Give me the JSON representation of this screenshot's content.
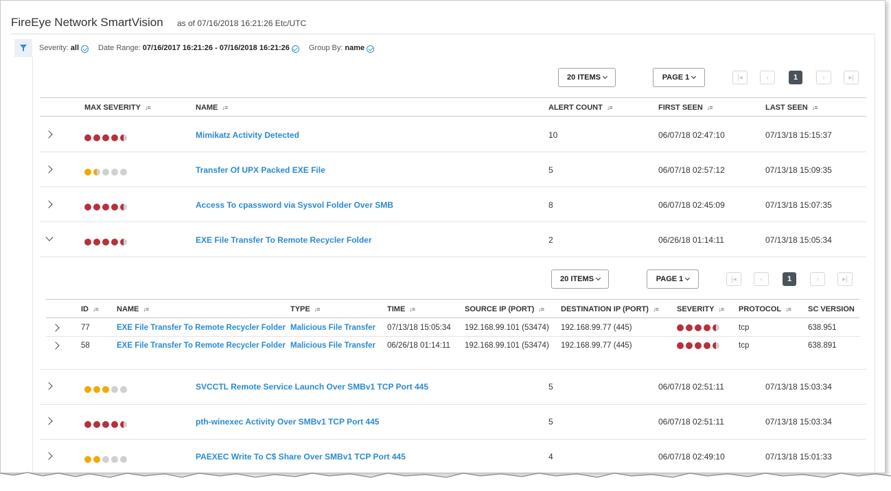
{
  "app": {
    "title": "FireEye Network SmartVision",
    "as_of": "as of 07/16/2018 16:21:26 Etc/UTC"
  },
  "filters": {
    "severity_label": "Severity:",
    "severity_value": "all",
    "date_label": "Date Range:",
    "date_value": "07/16/2017 16:21:26 - 07/16/2018 16:21:26",
    "group_label": "Group By:",
    "group_value": "name"
  },
  "pager": {
    "items_label": "20 ITEMS",
    "page_label": "PAGE 1",
    "current_page": "1"
  },
  "table": {
    "headers": {
      "max_severity": "MAX SEVERITY",
      "name": "NAME",
      "alert_count": "ALERT COUNT",
      "first_seen": "FIRST SEEN",
      "last_seen": "LAST SEEN"
    },
    "rows": [
      {
        "name": "Mimikatz Activity Detected",
        "alert_count": "10",
        "first_seen": "06/07/18 02:47:10",
        "last_seen": "07/13/18 15:15:37",
        "severity": 4.5,
        "color": "red",
        "expanded": false
      },
      {
        "name": "Transfer Of UPX Packed EXE File",
        "alert_count": "5",
        "first_seen": "06/07/18 02:57:12",
        "last_seen": "07/13/18 15:09:35",
        "severity": 1.5,
        "color": "orange",
        "expanded": false
      },
      {
        "name": "Access To cpassword via Sysvol Folder Over SMB",
        "alert_count": "8",
        "first_seen": "06/07/18 02:45:09",
        "last_seen": "07/13/18 15:07:35",
        "severity": 4.5,
        "color": "red",
        "expanded": false
      },
      {
        "name": "EXE File Transfer To Remote Recycler Folder",
        "alert_count": "2",
        "first_seen": "06/26/18 01:14:11",
        "last_seen": "07/13/18 15:05:34",
        "severity": 4.5,
        "color": "red",
        "expanded": true
      },
      {
        "name": "SVCCTL Remote Service Launch Over SMBv1 TCP Port 445",
        "alert_count": "5",
        "first_seen": "06/07/18 02:51:11",
        "last_seen": "07/13/18 15:03:34",
        "severity": 3,
        "color": "orange",
        "expanded": false
      },
      {
        "name": "pth-winexec Activity Over SMBv1 TCP Port 445",
        "alert_count": "5",
        "first_seen": "06/07/18 02:51:11",
        "last_seen": "07/13/18 15:03:34",
        "severity": 4.5,
        "color": "red",
        "expanded": false
      },
      {
        "name": "PAEXEC Write To C$ Share Over SMBv1 TCP Port 445",
        "alert_count": "4",
        "first_seen": "06/07/18 02:49:10",
        "last_seen": "07/13/18 15:01:33",
        "severity": 2,
        "color": "orange",
        "expanded": false
      }
    ]
  },
  "subtable": {
    "headers": {
      "id": "ID",
      "name": "NAME",
      "type": "TYPE",
      "time": "TIME",
      "source_ip": "SOURCE IP (PORT)",
      "dest_ip": "DESTINATION IP (PORT)",
      "severity": "SEVERITY",
      "protocol": "PROTOCOL",
      "sc_version": "SC VERSION"
    },
    "rows": [
      {
        "id": "77",
        "name": "EXE File Transfer To Remote Recycler Folder",
        "type": "Malicious File Transfer",
        "time": "07/13/18 15:05:34",
        "source_ip": "192.168.99.101 (53474)",
        "dest_ip": "192.168.99.77 (445)",
        "severity": 4.5,
        "protocol": "tcp",
        "sc_version": "638.951"
      },
      {
        "id": "58",
        "name": "EXE File Transfer To Remote Recycler Folder",
        "type": "Malicious File Transfer",
        "time": "06/26/18 01:14:11",
        "source_ip": "192.168.99.101 (53474)",
        "dest_ip": "192.168.99.77 (445)",
        "severity": 4.5,
        "protocol": "tcp",
        "sc_version": "638.891"
      }
    ]
  },
  "colors": {
    "link": "#2a8ad4",
    "sev_red": "#b8303a",
    "sev_orange": "#f2a900",
    "sev_empty": "#d0d0d0",
    "accent": "#2f8fd8"
  }
}
